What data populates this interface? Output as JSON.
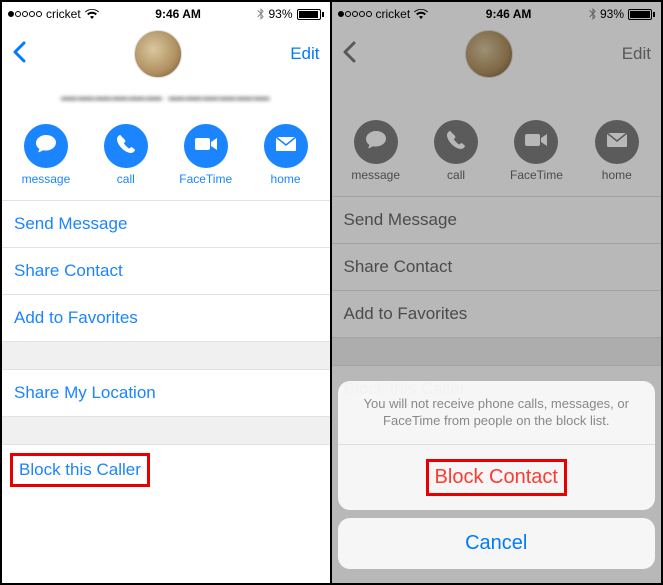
{
  "status": {
    "carrier": "cricket",
    "time": "9:46 AM",
    "battery_pct": "93%"
  },
  "nav": {
    "edit": "Edit"
  },
  "contact": {
    "name_masked": "——————  ——————"
  },
  "actions": {
    "message": "message",
    "call": "call",
    "facetime": "FaceTime",
    "home": "home"
  },
  "rows": {
    "send_message": "Send Message",
    "share_contact": "Share Contact",
    "add_favorites": "Add to Favorites",
    "share_location": "Share My Location",
    "block_caller": "Block this Caller"
  },
  "sheet": {
    "message": "You will not receive phone calls, messages, or FaceTime from people on the block list.",
    "block": "Block Contact",
    "cancel": "Cancel"
  }
}
